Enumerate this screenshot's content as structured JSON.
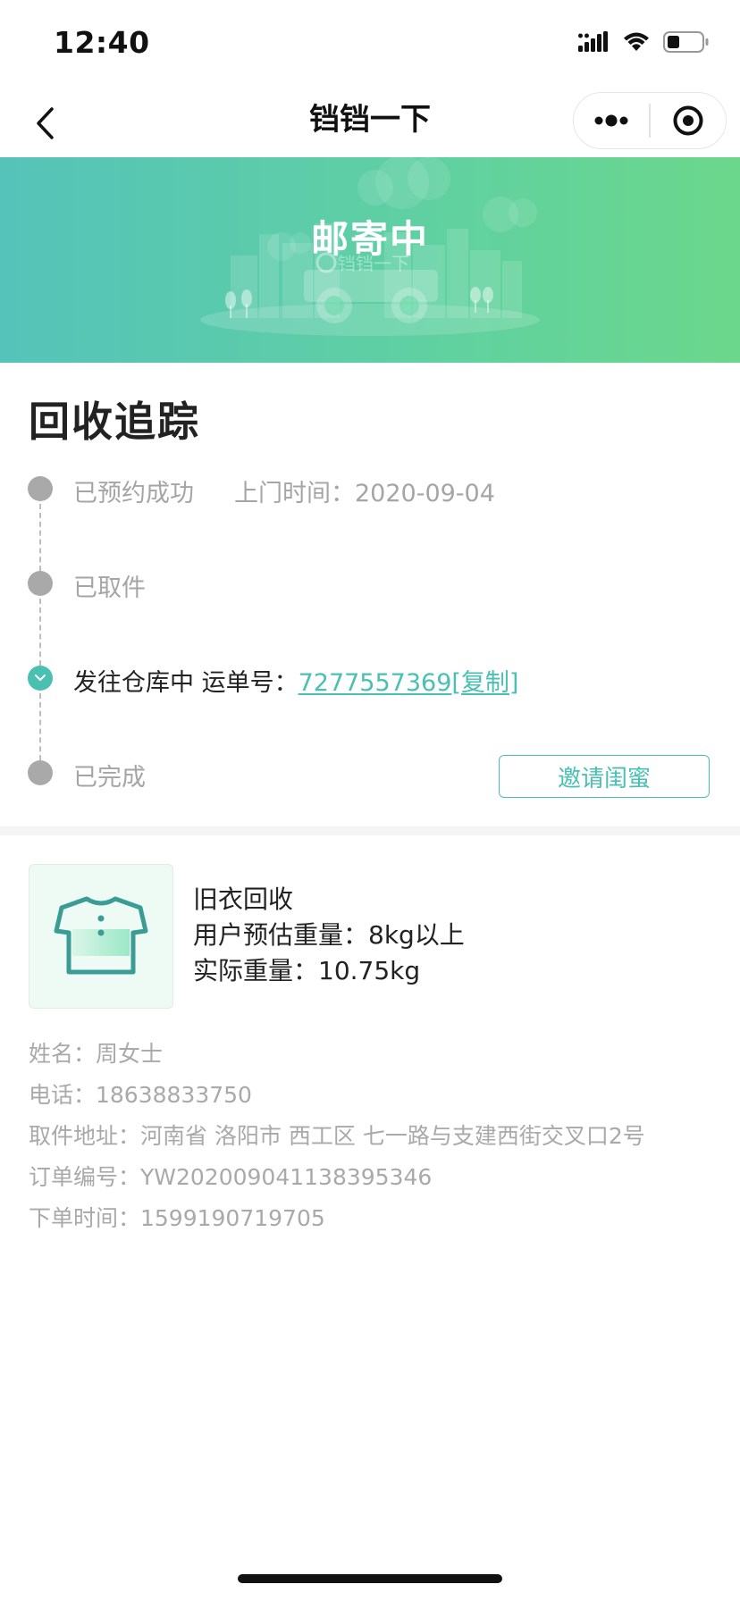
{
  "status_bar": {
    "time": "12:40"
  },
  "nav": {
    "title": "铛铛一下"
  },
  "banner": {
    "status": "邮寄中",
    "watermark": "铛铛一下"
  },
  "tracking": {
    "title": "回收追踪",
    "steps": [
      {
        "label": "已预约成功",
        "visit_label": "上门时间：",
        "visit_date": "2020-09-04"
      },
      {
        "label": "已取件"
      },
      {
        "label": "发往仓库中",
        "waybill_label": "运单号：",
        "waybill_number": "7277557369",
        "copy_label": "[复制]"
      },
      {
        "label": "已完成"
      }
    ],
    "invite_button": "邀请闺蜜"
  },
  "product": {
    "name": "旧衣回收",
    "estimate_line": "用户预估重量：8kg以上",
    "actual_line": "实际重量：10.75kg"
  },
  "order": {
    "name_line": "姓名：周女士",
    "phone_line": "电话：18638833750",
    "address_line": "取件地址：河南省 洛阳市 西工区 七一路与支建西街交叉口2号",
    "order_no_line": "订单编号：YW202009041138395346",
    "order_time_line": "下单时间：1599190719705"
  },
  "colors": {
    "accent": "#49c0b2",
    "banner_start": "#55c3b9",
    "banner_end": "#6bd78c",
    "muted_text": "#a5a5a5"
  },
  "icons": [
    "signal-icon",
    "wifi-icon",
    "battery-icon",
    "back-chevron-icon",
    "more-icon",
    "capsule-close-icon",
    "check-icon",
    "tshirt-icon"
  ]
}
